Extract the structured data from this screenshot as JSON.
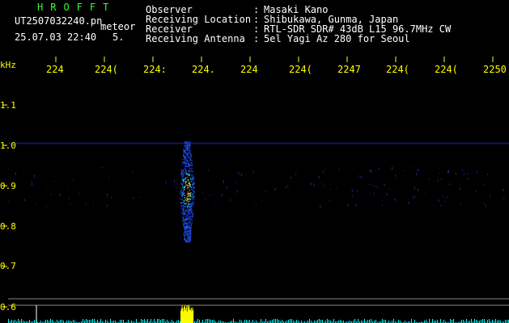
{
  "app": {
    "title": "HROFFT"
  },
  "file": {
    "name": "UT2507032240.pn",
    "type": "meteor",
    "datetime": "25.07.03 22:40",
    "count": "5."
  },
  "info": [
    {
      "label": "Observer",
      "value": "Masaki Kano"
    },
    {
      "label": "Receiving Location",
      "value": "Shibukawa, Gunma, Japan"
    },
    {
      "label": "Receiver",
      "value": "RTL-SDR SDR# 43dB L15 96.7MHz CW"
    },
    {
      "label": "Receiving Antenna",
      "value": "5el Yagi Az 280 for Seoul"
    }
  ],
  "colors": {
    "text": "#ffffff",
    "title": "#33ff33",
    "axis": "#ffff00",
    "meter": "#00ffff",
    "burst": "#ffff00"
  },
  "chart_data": {
    "type": "heatmap",
    "ylabel": "kHz",
    "y_ticks": [
      "1.1",
      "1.0",
      "0.9",
      "0.8",
      "0.7",
      "0.6"
    ],
    "x_ticks": [
      "2241",
      "2242",
      "2243",
      "2244",
      "2245",
      "2246",
      "2247",
      "2248",
      "2249",
      "2250"
    ],
    "x_tick_visible": [
      "224",
      "224(",
      "224:",
      "224.",
      "224",
      "224(",
      "2247",
      "224(",
      "224(",
      "2250"
    ],
    "ylim": [
      0.6,
      1.15
    ],
    "carrier_khz": 1.005,
    "meteor_echo": {
      "time_min": 2243.7,
      "freq_range_khz": [
        0.76,
        1.01
      ],
      "peak_khz": 0.89
    }
  }
}
